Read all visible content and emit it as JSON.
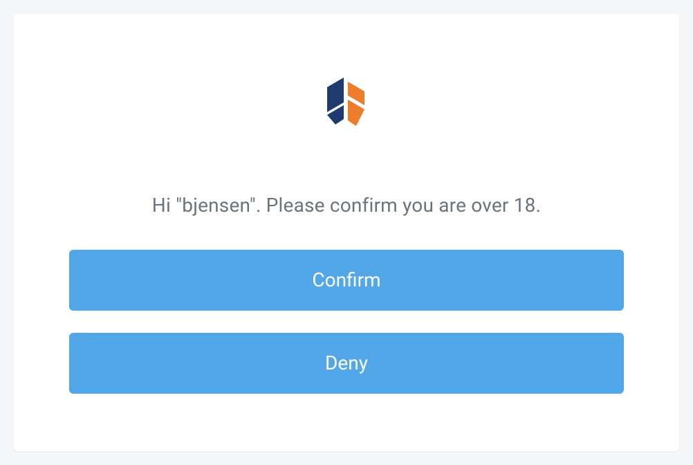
{
  "message": "Hi \"bjensen\". Please confirm you are over 18.",
  "buttons": {
    "confirm_label": "Confirm",
    "deny_label": "Deny"
  },
  "colors": {
    "primary": "#51a7e8",
    "logo_blue": "#1e3a6e",
    "logo_orange": "#ed7d2b"
  }
}
